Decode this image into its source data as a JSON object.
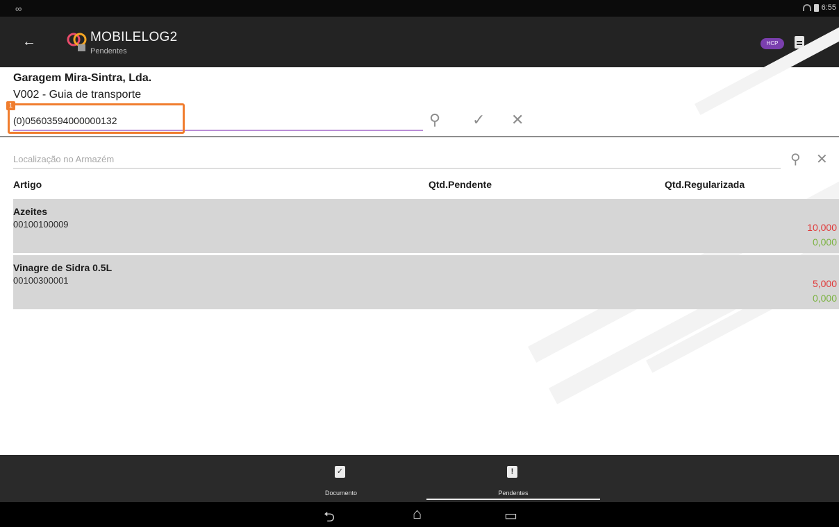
{
  "status_bar": {
    "left_icon": "infinity-icon",
    "time": "6:55"
  },
  "action_bar": {
    "title": "MOBILELOG2",
    "subtitle": "Pendentes",
    "badge_label": "HCP",
    "icons": [
      "back-arrow-icon",
      "app-logo",
      "document-icon",
      "more-vert-icon"
    ]
  },
  "header": {
    "company": "Garagem Mira-Sintra, Lda.",
    "document_type": "V002 - Guia de transporte"
  },
  "barcode": {
    "value": "(0)05603594000000132",
    "marker_number": "1"
  },
  "location": {
    "placeholder": "Localização no Armazém"
  },
  "columns": {
    "artigo": "Artigo",
    "pendente": "Qtd.Pendente",
    "regularizada": "Qtd.Regularizada"
  },
  "items": [
    {
      "name": "Azeites",
      "code": "00100100009",
      "qtd_pendente": "10,000",
      "qtd_regularizada": "0,000"
    },
    {
      "name": "Vinagre de Sidra 0.5L",
      "code": "00100300001",
      "qtd_pendente": "5,000",
      "qtd_regularizada": "0,000"
    }
  ],
  "tabs": [
    {
      "label": "Documento",
      "icon": "clipboard-check-icon",
      "active": false
    },
    {
      "label": "Pendentes",
      "icon": "clipboard-alert-icon",
      "active": true
    }
  ],
  "colors": {
    "action_bar": "#232323",
    "highlight": "#f07d2e",
    "qty_pendente": "#e03a3a",
    "qty_regularizada": "#7cb342",
    "row_background": "#d6d6d6",
    "accent": "#7a3fae"
  }
}
